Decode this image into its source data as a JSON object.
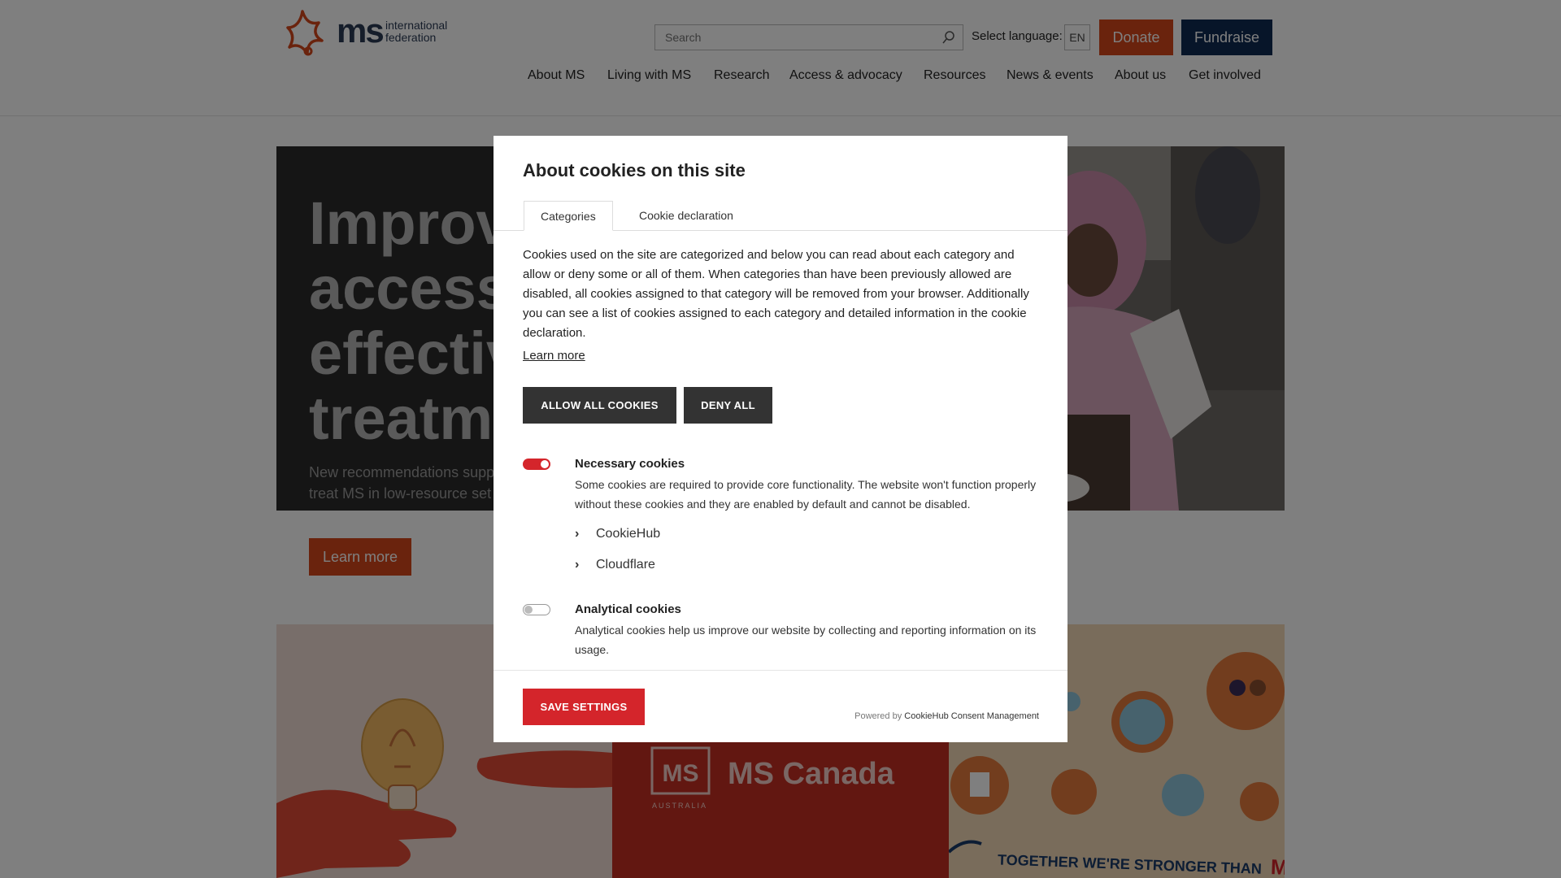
{
  "header": {
    "logo": {
      "ms": "ms",
      "line1": "international",
      "line2": "federation"
    },
    "search": {
      "placeholder": "Search"
    },
    "language": {
      "label": "Select language:",
      "value": "EN"
    },
    "donate_label": "Donate",
    "fundraise_label": "Fundraise",
    "nav": [
      "About MS",
      "Living with MS",
      "Research",
      "Access & advocacy",
      "Resources",
      "News & events",
      "About us",
      "Get involved"
    ]
  },
  "hero": {
    "title_lines": [
      "Improvi",
      "access t",
      "effectiv",
      "treatme"
    ],
    "description": "New recommendations supp\ntreat MS in low-resource set",
    "learn_more": "Learn more"
  },
  "cards": {
    "card2_logo_left": "MS",
    "card2_logo_sub": "AUSTRALIA",
    "card2_logo_right": "MS Canada",
    "card3_text": "TOGETHER WE'RE STRONGER THAN",
    "card3_ms": "MS"
  },
  "cookie_dialog": {
    "title": "About cookies on this site",
    "tabs": [
      "Categories",
      "Cookie declaration"
    ],
    "body": "Cookies used on the site are categorized and below you can read about each category and allow or deny some or all of them. When categories than have been previously allowed are disabled, all cookies assigned to that category will be removed from your browser. Additionally you can see a list of cookies assigned to each category and detailed information in the cookie declaration.",
    "learn_more": "Learn more",
    "allow_all": "ALLOW ALL COOKIES",
    "deny_all": "DENY ALL",
    "categories": [
      {
        "title": "Necessary cookies",
        "description": "Some cookies are required to provide core functionality. The website won't function properly without these cookies and they are enabled by default and cannot be disabled.",
        "enabled": true,
        "vendors": [
          "CookieHub",
          "Cloudflare"
        ]
      },
      {
        "title": "Analytical cookies",
        "description": "Analytical cookies help us improve our website by collecting and reporting information on its usage.",
        "enabled": false
      }
    ],
    "save_settings": "SAVE SETTINGS",
    "powered_by_prefix": "Powered by",
    "powered_by_name": "CookieHub Consent Management"
  },
  "colors": {
    "accent_orange": "#d4471b",
    "navy": "#0f2a52",
    "cookie_red": "#d4252b"
  }
}
